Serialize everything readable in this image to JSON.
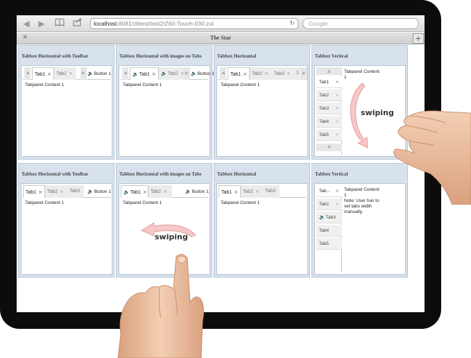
{
  "browser": {
    "back_icon": "back-arrow-icon",
    "forward_icon": "forward-arrow-icon",
    "bookmarks_icon": "book-icon",
    "share_icon": "share-icon",
    "url_host": "localhost",
    "url_rest": ":8081/zktest/test2/Z60-Touch-030.zul",
    "reload_icon": "reload-icon",
    "search_placeholder": "Google"
  },
  "window": {
    "close": "×",
    "title": "The Star",
    "add": "+"
  },
  "panels": [
    {
      "title": "Tabbox Horizontal with Toolbar",
      "tabs": [
        {
          "label": "Tab1",
          "x": "×"
        },
        {
          "label": "Tab2",
          "x": "×"
        }
      ],
      "button": "Button 1",
      "content": "Tabpanel Content 1"
    },
    {
      "title": "Tabbox Horizontal with images on Tabs",
      "tabs": [
        {
          "label": "Tab1",
          "x": "×"
        },
        {
          "label": "Tab2",
          "x": "×"
        }
      ],
      "button": "Button 1",
      "content": "Tabpanel Content 1"
    },
    {
      "title": "Tabbox Horizontal",
      "tabs": [
        {
          "label": "Tab1",
          "x": "×"
        },
        {
          "label": "Tab2",
          "x": "×"
        },
        {
          "label": "Tab3",
          "x": "×"
        },
        {
          "label": "1"
        }
      ],
      "content": "Tabpanel Content 1"
    },
    {
      "title": "Tabbox Vertical",
      "tabs": [
        {
          "label": "Tab1",
          "x": "×"
        },
        {
          "label": "Tab2",
          "x": "×"
        },
        {
          "label": "Tab3",
          "x": "×"
        },
        {
          "label": "Tab4",
          "x": "×"
        },
        {
          "label": "Tab5",
          "x": "×"
        }
      ],
      "content": "Tabpanel Content 1"
    },
    {
      "title": "Tabbox Horizontal with Toolbar",
      "tabs": [
        {
          "label": "Tab1",
          "x": "×"
        },
        {
          "label": "Tab2",
          "x": "×"
        },
        {
          "label": "Tab3"
        }
      ],
      "button": "Button 1",
      "content": "Tabpanel Content 1"
    },
    {
      "title": "Tabbox Horizontal with images on Tabs",
      "tabs": [
        {
          "label": "Tab1",
          "x": "×"
        },
        {
          "label": "Tab2",
          "x": "×"
        }
      ],
      "button": "Button 1",
      "content": "Tabpanel Content 1"
    },
    {
      "title": "Tabbox Horizontal",
      "tabs": [
        {
          "label": "Tab1",
          "x": "×"
        },
        {
          "label": "Tab2",
          "x": "×"
        },
        {
          "label": "Tab3"
        }
      ],
      "content": "Tabpanel Content 1"
    },
    {
      "title": "Tabbox Vertical",
      "tabs": [
        {
          "label": "Tab...",
          "x": "×"
        },
        {
          "label": "Tab2",
          "x": "×"
        },
        {
          "label": "Tab3"
        },
        {
          "label": "Tab4"
        },
        {
          "label": "Tab5"
        }
      ],
      "content": "Tabpanel Content 1",
      "note": "Note: User has to set tabs width manually."
    }
  ],
  "gestures": {
    "swipe_vertical": "swiping",
    "swipe_horizontal": "swiping",
    "arrow_color": "#f3b3b3",
    "skin_color": "#e9b898"
  }
}
